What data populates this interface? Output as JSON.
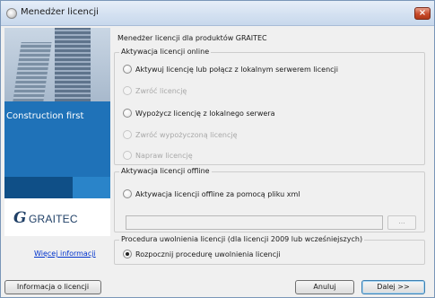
{
  "window": {
    "title": "Menedżer licencji",
    "close_label": "×",
    "icon": "app-icon"
  },
  "banner": {
    "tagline": "Construction first",
    "logo_mark": "G",
    "logo_text": "GRAITEC"
  },
  "header": {
    "text": "Menedżer licencji dla produktów GRAITEC"
  },
  "online_group": {
    "title": "Aktywacja licencji online",
    "options": [
      {
        "label": "Aktywuj licencję lub połącz z lokalnym serwerem licencji",
        "enabled": true,
        "selected": false
      },
      {
        "label": "Zwróć licencję",
        "enabled": false,
        "selected": false
      },
      {
        "label": "Wypożycz licencję z lokalnego serwera",
        "enabled": true,
        "selected": false
      },
      {
        "label": "Zwróć wypożyczoną licencję",
        "enabled": false,
        "selected": false
      },
      {
        "label": "Napraw licencję",
        "enabled": false,
        "selected": false
      }
    ]
  },
  "offline_group": {
    "title": "Aktywacja licencji offline",
    "option_label": "Aktywacja licencji offline za pomocą pliku xml",
    "file_value": "",
    "browse_label": "..."
  },
  "procedure_group": {
    "title": "Procedura uwolnienia licencji (dla licencji 2009 lub wcześniejszych)",
    "option_label": "Rozpocznij procedurę uwolnienia licencji",
    "selected": true
  },
  "links": {
    "more_info": "Więcej informacji"
  },
  "buttons": {
    "info": "Informacja o licencji",
    "cancel": "Anuluj",
    "next": "Dalej >>"
  },
  "colors": {
    "banner_blue": "#1f72b8",
    "banner_dark": "#0f4f87",
    "link": "#0033cc",
    "close_red": "#c84a2a"
  }
}
